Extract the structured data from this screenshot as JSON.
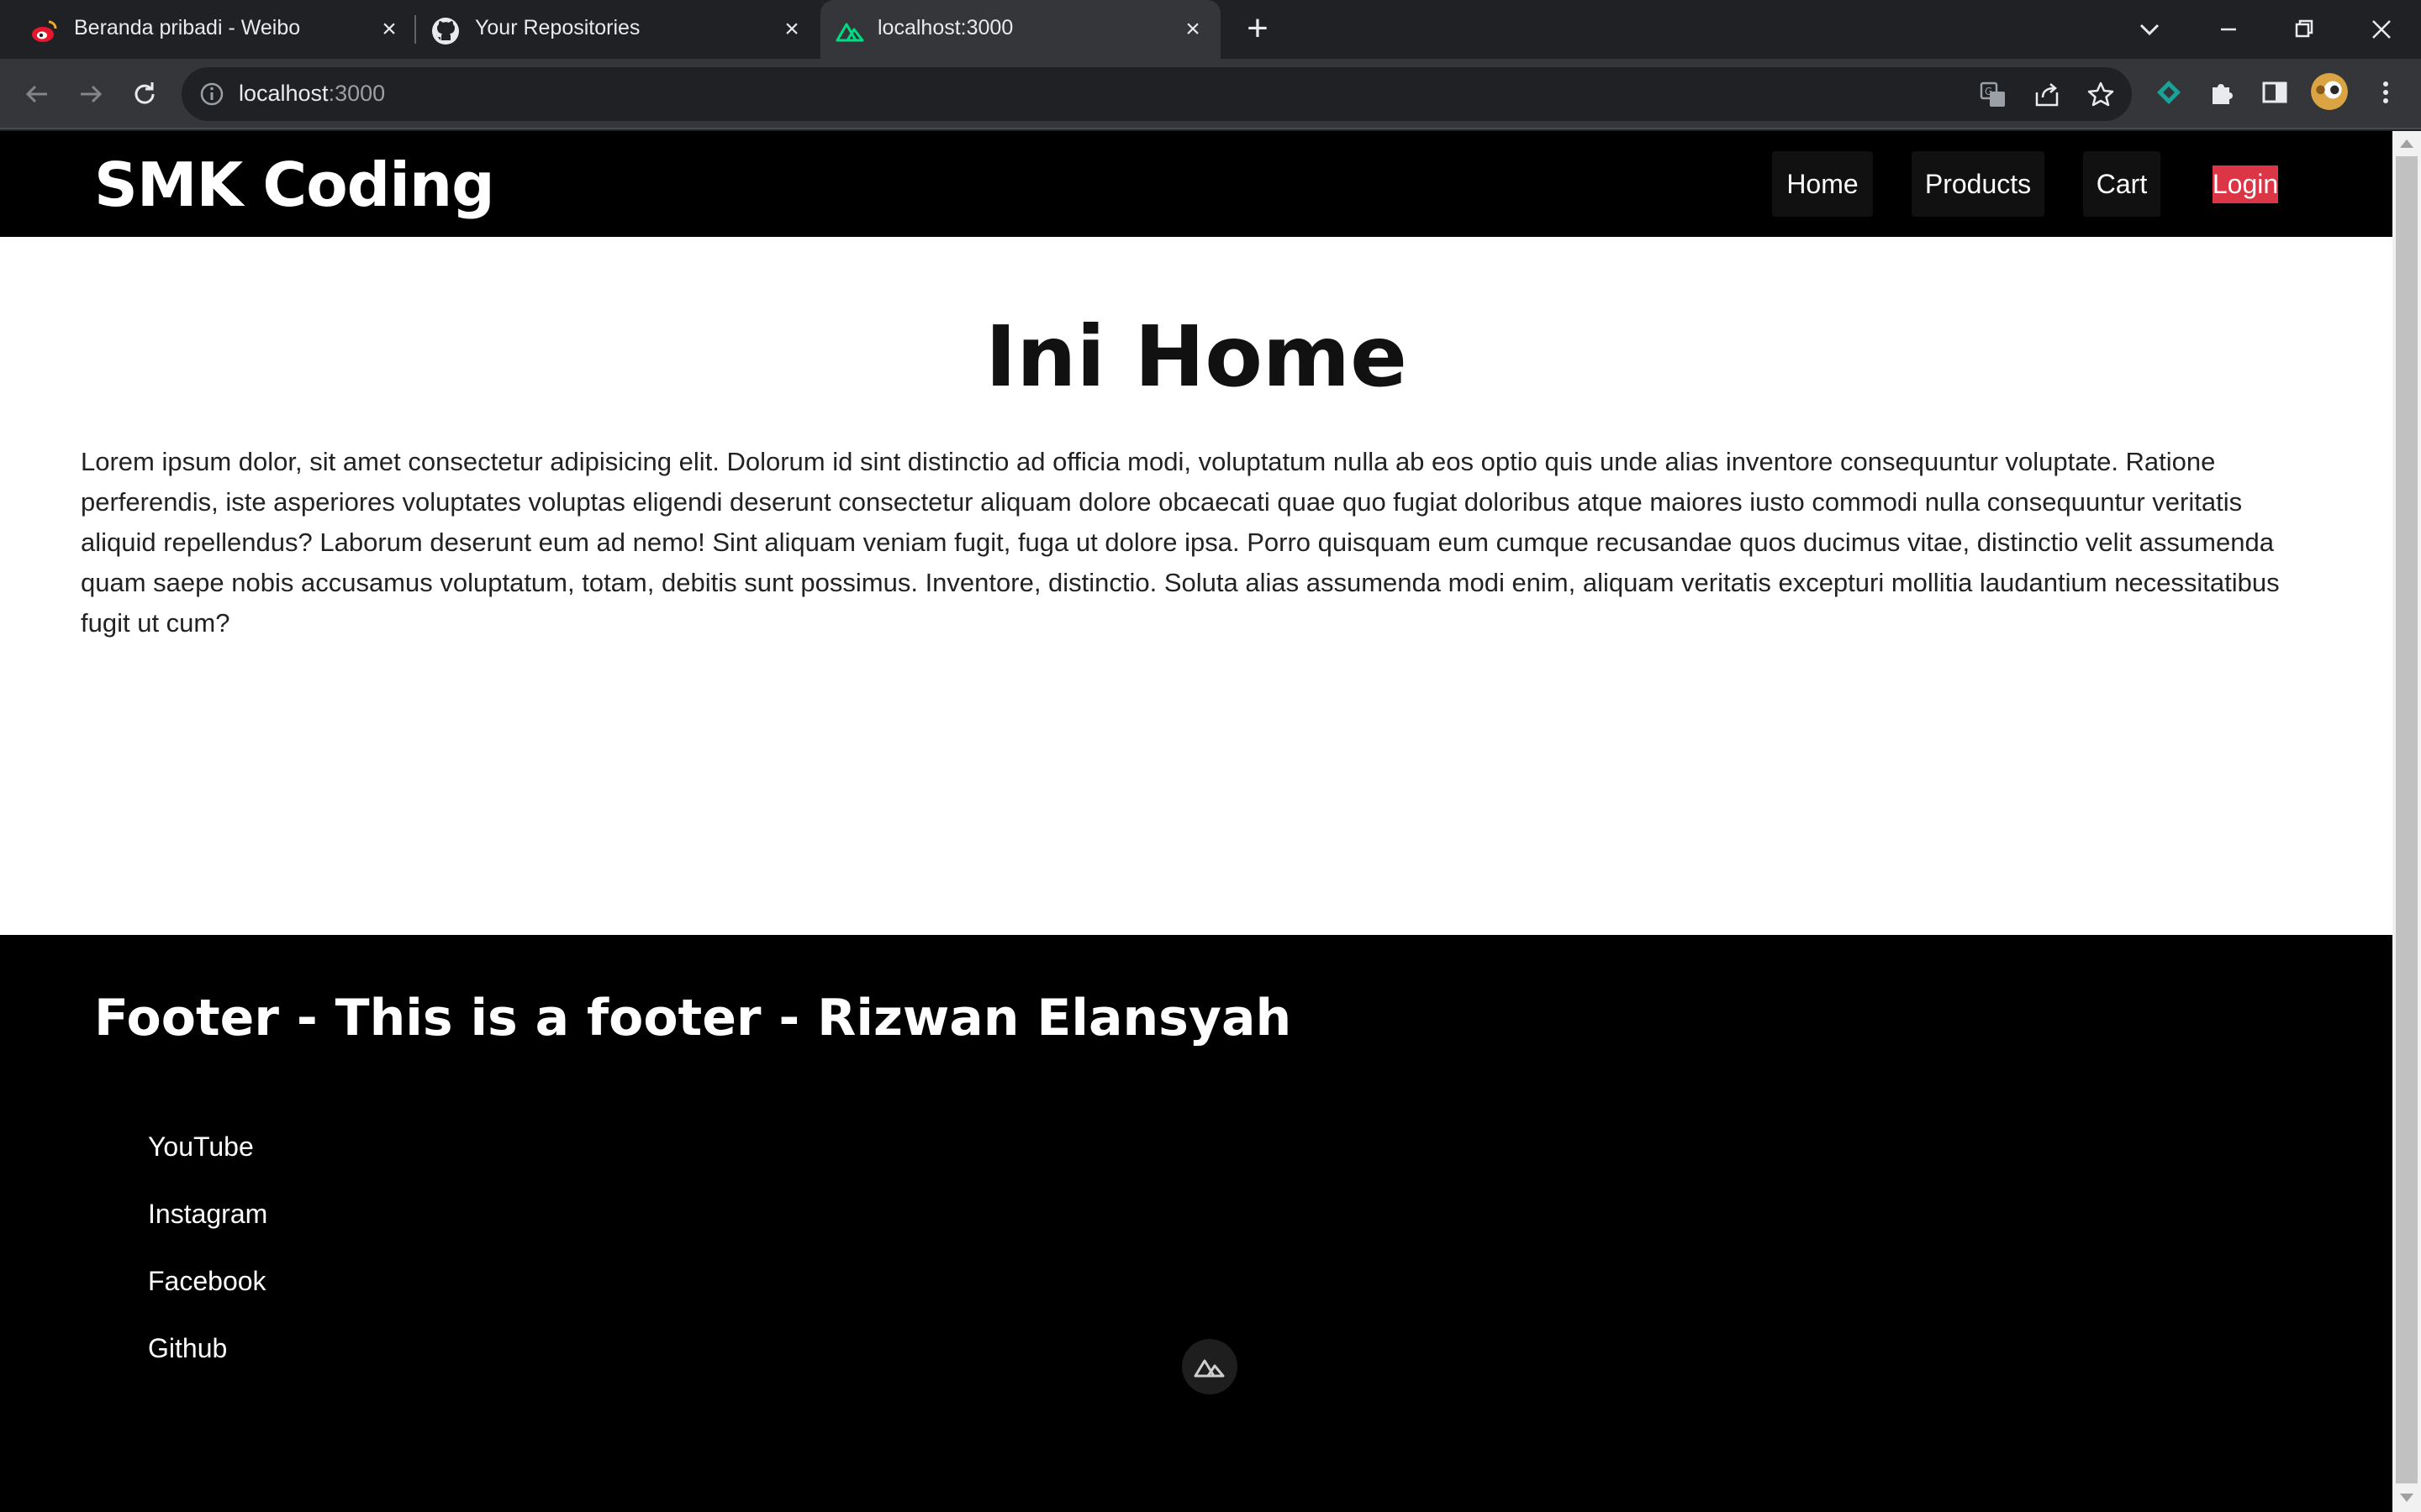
{
  "browser": {
    "tabs": [
      {
        "title": "Beranda pribadi - Weibo",
        "icon": "weibo-icon"
      },
      {
        "title": "Your Repositories",
        "icon": "github-icon"
      },
      {
        "title": "localhost:3000",
        "icon": "nuxt-icon",
        "active": true
      }
    ],
    "address": {
      "host": "localhost",
      "port": ":3000"
    },
    "colors": {
      "chrome_dark": "#202124",
      "chrome_toolbar": "#35363a"
    }
  },
  "site": {
    "brand": "SMK Coding",
    "nav": [
      {
        "label": "Home"
      },
      {
        "label": "Products"
      },
      {
        "label": "Cart"
      },
      {
        "label": "Login"
      }
    ],
    "title": "Ini Home",
    "body": "Lorem ipsum dolor, sit amet consectetur adipisicing elit. Dolorum id sint distinctio ad officia modi, voluptatum nulla ab eos optio quis unde alias inventore consequuntur voluptate. Ratione perferendis, iste asperiores voluptates voluptas eligendi deserunt consectetur aliquam dolore obcaecati quae quo fugiat doloribus atque maiores iusto commodi nulla consequuntur veritatis aliquid repellendus? Laborum deserunt eum ad nemo! Sint aliquam veniam fugit, fuga ut dolore ipsa. Porro quisquam eum cumque recusandae quos ducimus vitae, distinctio velit assumenda quam saepe nobis accusamus voluptatum, totam, debitis sunt possimus. Inventore, distinctio. Soluta alias assumenda modi enim, aliquam veritatis excepturi mollitia laudantium necessitatibus fugit ut cum?",
    "footer": {
      "title": "Footer - This is a footer - Rizwan Elansyah",
      "links": [
        {
          "label": "YouTube"
        },
        {
          "label": "Instagram"
        },
        {
          "label": "Facebook"
        },
        {
          "label": "Github"
        }
      ]
    },
    "colors": {
      "header_bg": "#000000",
      "login_bg": "#dc3545",
      "footer_bg": "#000000"
    }
  }
}
